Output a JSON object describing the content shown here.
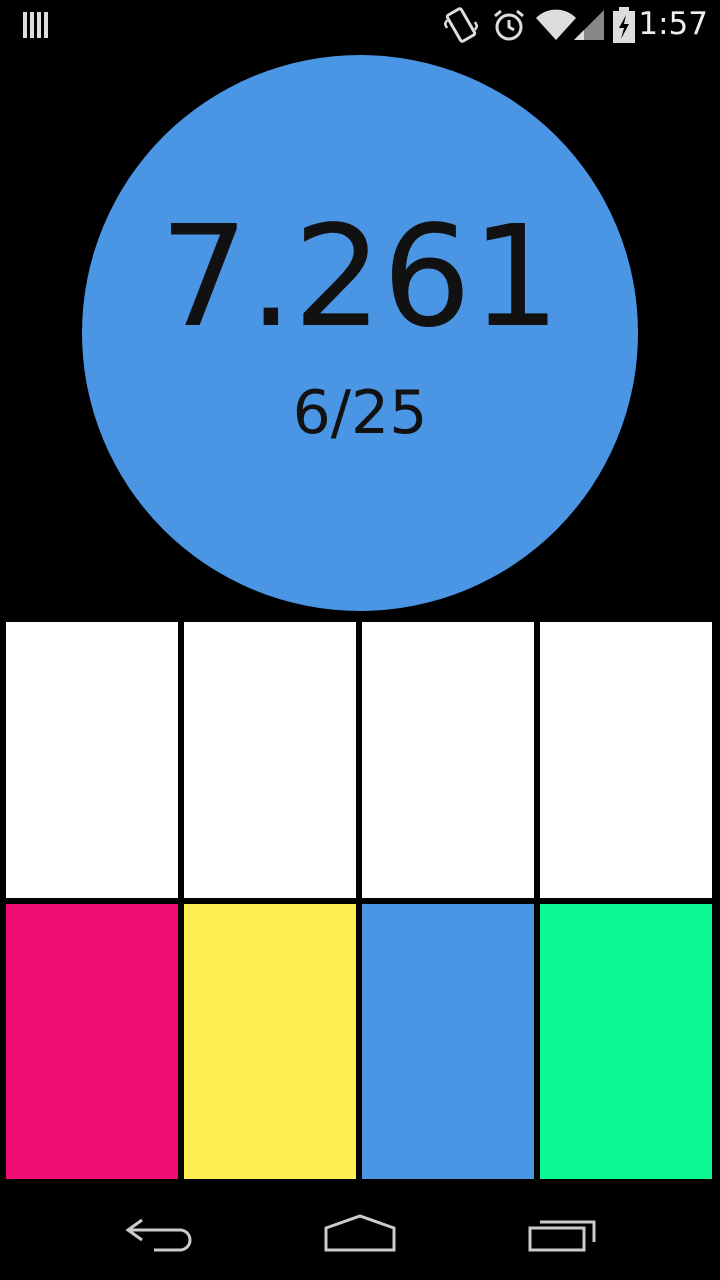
{
  "status_bar": {
    "time": "1:57"
  },
  "game": {
    "score": "7.261",
    "progress": "6/25",
    "circle_color": "#4a96e4"
  },
  "tiles": {
    "top_row": [
      {
        "color": "#ffffff"
      },
      {
        "color": "#ffffff"
      },
      {
        "color": "#ffffff"
      },
      {
        "color": "#ffffff"
      }
    ],
    "bottom_row": [
      {
        "color": "#ef0d75"
      },
      {
        "color": "#ffee52"
      },
      {
        "color": "#4a96e4"
      },
      {
        "color": "#0cfa94"
      }
    ]
  },
  "nav_bar": {
    "icons": [
      "back-icon",
      "home-icon",
      "recents-icon"
    ]
  }
}
